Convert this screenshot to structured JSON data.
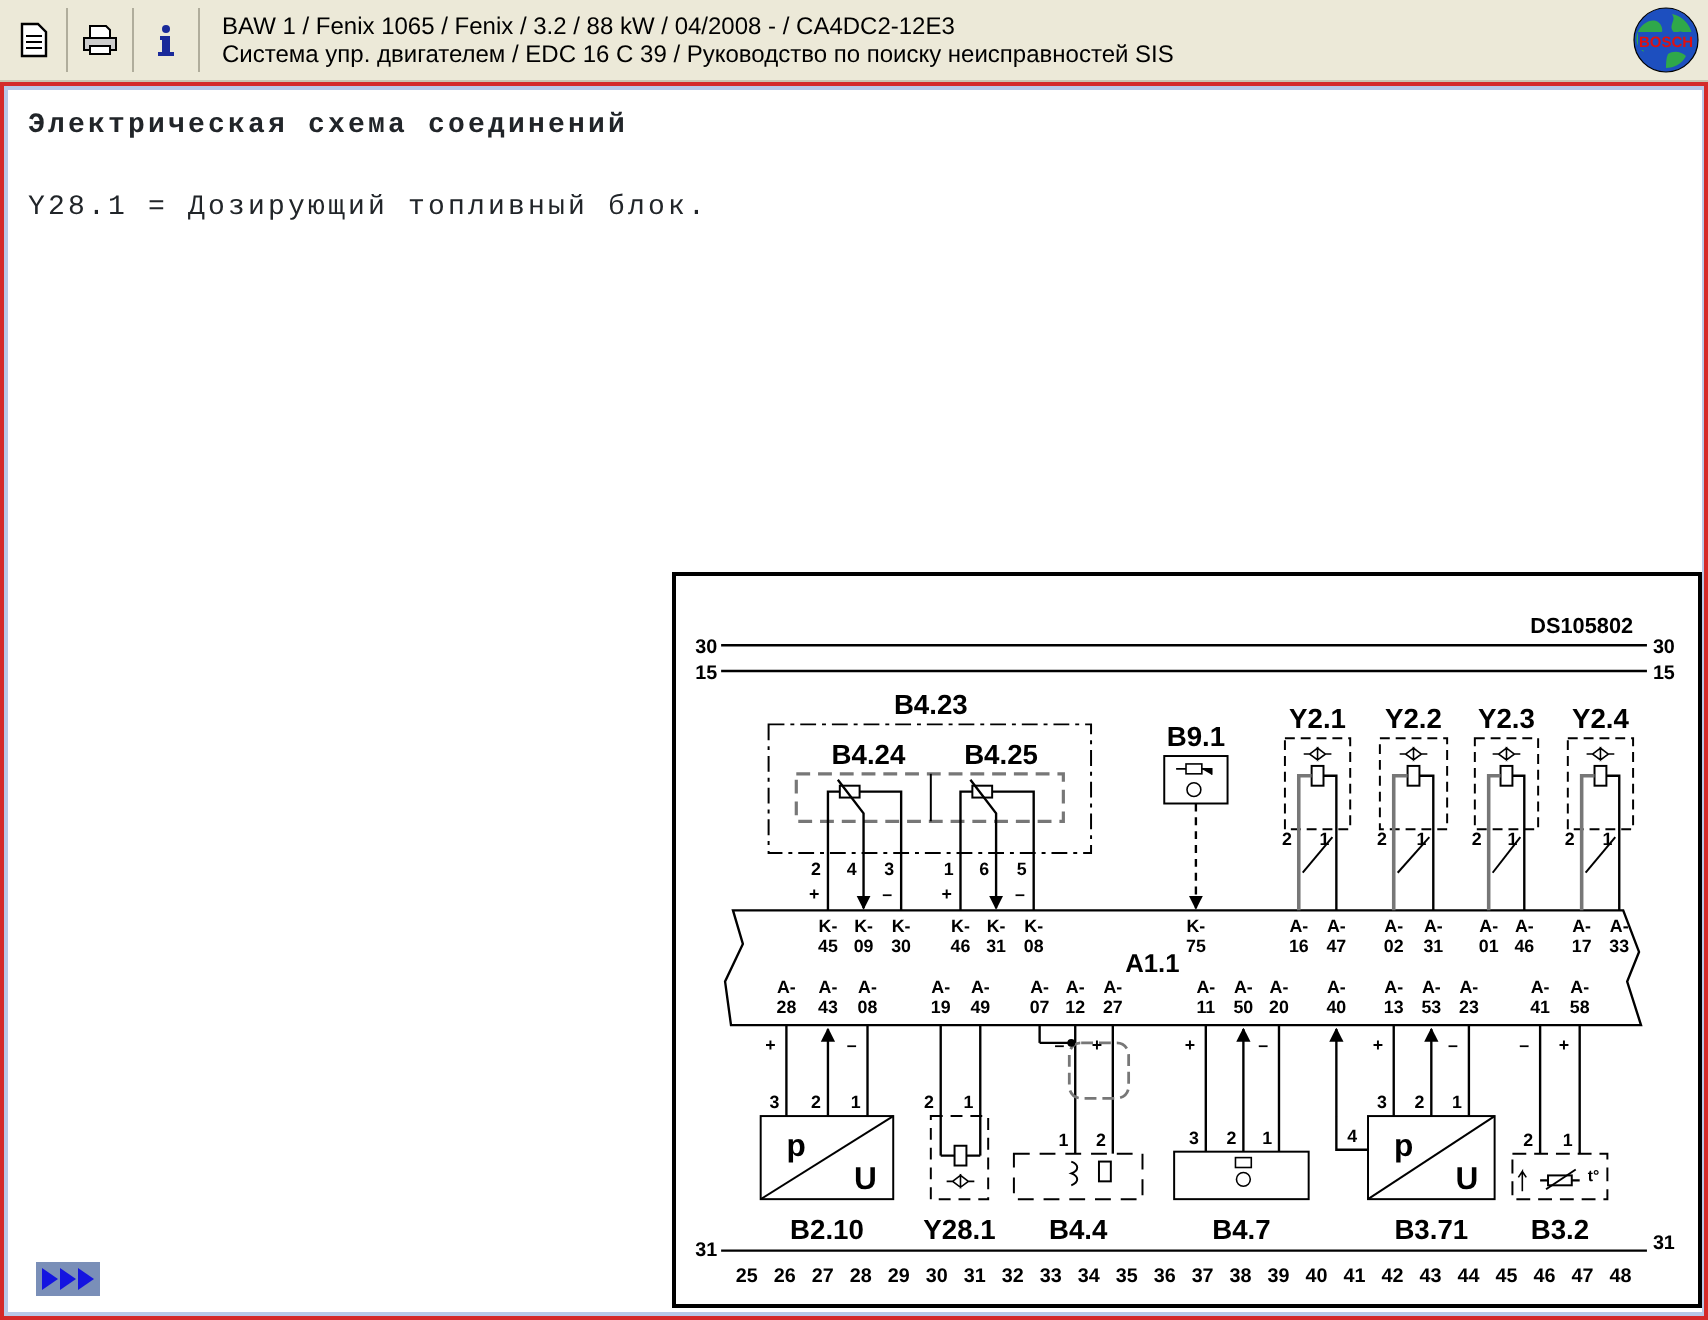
{
  "header": {
    "line_1": "BAW 1 / Fenix 1065 / Fenix / 3.2 / 88 kW / 04/2008 -  / CA4DC2-12E3",
    "line_2": "Система упр. двигателем / EDC 16 C 39 / Руководство по поиску неисправностей SIS"
  },
  "logo": {
    "text": "BOSCH"
  },
  "content": {
    "title": "Электрическая схема соединений",
    "description": "Y28.1 = Дозирующий топливный блок."
  },
  "diagram": {
    "drawing_number": "DS105802",
    "rails": [
      {
        "left_label": "30",
        "right_label": "30"
      },
      {
        "left_label": "15",
        "right_label": "15"
      }
    ],
    "ground_rail": {
      "left_label": "31",
      "right_label": "31"
    },
    "ecu": {
      "label": "A1.1"
    },
    "group": {
      "label": "B4.23"
    },
    "top_components": [
      {
        "kind": "potentiometer",
        "label": "B4.24",
        "pins": [
          "2",
          "4",
          "3"
        ],
        "sockets": [
          {
            "sign": "+",
            "prefix": "K-",
            "number": "45"
          },
          {
            "prefix": "K-",
            "number": "09"
          },
          {
            "sign": "–",
            "prefix": "K-",
            "number": "30"
          }
        ]
      },
      {
        "kind": "potentiometer",
        "label": "B4.25",
        "pins": [
          "1",
          "6",
          "5"
        ],
        "sockets": [
          {
            "sign": "+",
            "prefix": "K-",
            "number": "46"
          },
          {
            "prefix": "K-",
            "number": "31"
          },
          {
            "sign": "–",
            "prefix": "K-",
            "number": "08"
          }
        ]
      },
      {
        "kind": "sensor",
        "label": "B9.1",
        "sockets": [
          {
            "prefix": "K-",
            "number": "75"
          }
        ]
      },
      {
        "kind": "valve",
        "label": "Y2.1",
        "pins": [
          "2",
          "1"
        ],
        "sockets": [
          {
            "prefix": "A-",
            "number": "16"
          },
          {
            "prefix": "A-",
            "number": "47"
          }
        ]
      },
      {
        "kind": "valve",
        "label": "Y2.2",
        "pins": [
          "2",
          "1"
        ],
        "sockets": [
          {
            "prefix": "A-",
            "number": "02"
          },
          {
            "prefix": "A-",
            "number": "31"
          }
        ]
      },
      {
        "kind": "valve",
        "label": "Y2.3",
        "pins": [
          "2",
          "1"
        ],
        "sockets": [
          {
            "prefix": "A-",
            "number": "01"
          },
          {
            "prefix": "A-",
            "number": "46"
          }
        ]
      },
      {
        "kind": "valve",
        "label": "Y2.4",
        "pins": [
          "2",
          "1"
        ],
        "sockets": [
          {
            "prefix": "A-",
            "number": "17"
          },
          {
            "prefix": "A-",
            "number": "33"
          }
        ]
      }
    ],
    "bottom_components": [
      {
        "kind": "pressure",
        "label": "B2.10",
        "symbol_top": "p",
        "symbol_bottom": "U",
        "pins": [
          "3",
          "2",
          "1"
        ],
        "sockets": [
          {
            "sign": "+",
            "prefix": "A-",
            "number": "28"
          },
          {
            "prefix": "A-",
            "number": "43"
          },
          {
            "sign": "–",
            "prefix": "A-",
            "number": "08"
          }
        ]
      },
      {
        "kind": "valve",
        "label": "Y28.1",
        "pins": [
          "2",
          "1"
        ],
        "sockets": [
          {
            "prefix": "A-",
            "number": "19"
          },
          {
            "prefix": "A-",
            "number": "49"
          }
        ]
      },
      {
        "kind": "coil",
        "label": "B4.4",
        "pins": [
          "1",
          "2"
        ],
        "sockets": [
          {
            "prefix": "A-",
            "number": "07"
          },
          {
            "sign": "–",
            "prefix": "A-",
            "number": "12"
          },
          {
            "sign": "+",
            "prefix": "A-",
            "number": "27"
          }
        ]
      },
      {
        "kind": "sensor",
        "label": "B4.7",
        "pins": [
          "3",
          "2",
          "1"
        ],
        "sockets": [
          {
            "sign": "+",
            "prefix": "A-",
            "number": "11"
          },
          {
            "prefix": "A-",
            "number": "50"
          },
          {
            "sign": "–",
            "prefix": "A-",
            "number": "20"
          }
        ]
      },
      {
        "kind": "pressure",
        "label": "B3.71",
        "symbol_top": "p",
        "symbol_bottom": "U",
        "pins": [
          "4",
          "3",
          "2",
          "1"
        ],
        "sockets": [
          {
            "prefix": "A-",
            "number": "40"
          },
          {
            "sign": "+",
            "prefix": "A-",
            "number": "13"
          },
          {
            "prefix": "A-",
            "number": "53"
          },
          {
            "sign": "–",
            "prefix": "A-",
            "number": "23"
          }
        ]
      },
      {
        "kind": "temperature",
        "label": "B3.2",
        "symbol_top": "t°",
        "pins": [
          "2",
          "1"
        ],
        "sockets": [
          {
            "sign": "–",
            "prefix": "A-",
            "number": "41"
          },
          {
            "sign": "+",
            "prefix": "A-",
            "number": "58"
          }
        ]
      }
    ],
    "cell_numbers": [
      "25",
      "26",
      "27",
      "28",
      "29",
      "30",
      "31",
      "32",
      "33",
      "34",
      "35",
      "36",
      "37",
      "38",
      "39",
      "40",
      "41",
      "42",
      "43",
      "44",
      "45",
      "46",
      "47",
      "48"
    ]
  }
}
